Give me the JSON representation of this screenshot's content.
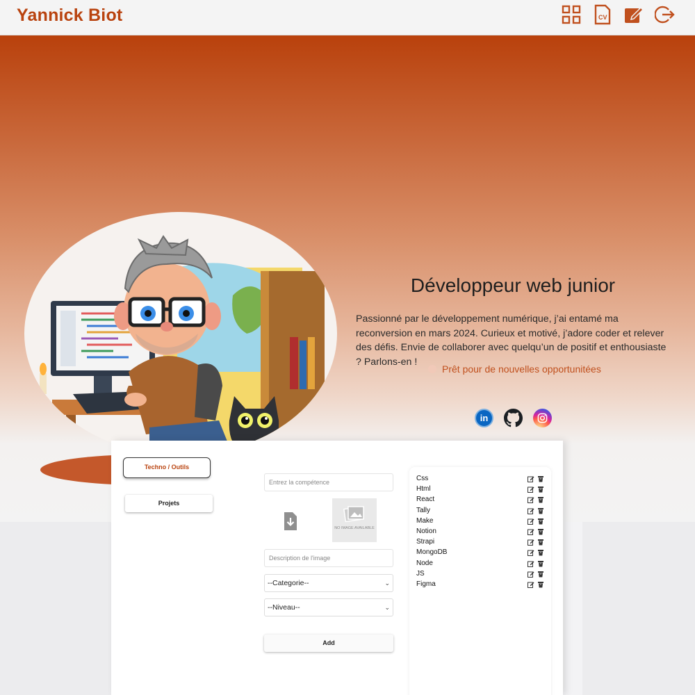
{
  "header": {
    "brand": "Yannick Biot",
    "icons": [
      "grid-icon",
      "cv-icon",
      "edit-icon",
      "logout-icon"
    ],
    "cv_label": "CV",
    "accent": "#b9430f"
  },
  "hero": {
    "headline": "Développeur web junior",
    "bio": "Passionné par le développement numérique, j’ai entamé ma reconversion en mars 2024. Curieux et motivé, j’adore coder et relever des défis. Envie de collaborer avec quelqu’un de positif et enthousiaste ? Parlons-en !",
    "status": "Prêt pour de nouvelles opportunitées",
    "socials": [
      "linkedin-icon",
      "github-icon",
      "instagram-icon"
    ],
    "linkedin_label": "in"
  },
  "panel": {
    "tabs": [
      {
        "label": "Techno / Outils",
        "active": true
      },
      {
        "label": "Projets",
        "active": false
      }
    ],
    "form": {
      "skill_placeholder": "Entrez la compétence",
      "image_placeholder": "NO IMAGE AVAILABLE",
      "description_placeholder": "Description de l'image",
      "category_value": "--Categorie--",
      "level_value": "--Niveau--",
      "add_label": "Add"
    },
    "skills": [
      "Css",
      "Html",
      "React",
      "Tally",
      "Make",
      "Notion",
      "Strapi",
      "MongoDB",
      "Node",
      "JS",
      "Figma"
    ]
  }
}
